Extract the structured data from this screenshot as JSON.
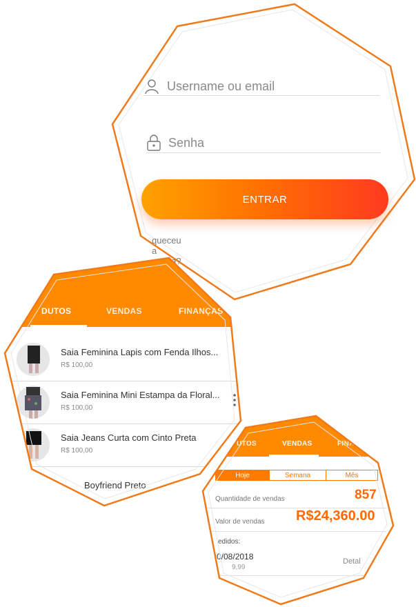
{
  "login": {
    "username_placeholder": "Username ou email",
    "password_placeholder": "Senha",
    "submit_label": "ENTRAR",
    "forgot_label": "queceu a senha?"
  },
  "products_screen": {
    "tabs": [
      "DUTOS",
      "VENDAS",
      "FINANÇAS"
    ],
    "items": [
      {
        "name": "Saia Feminina Lapis com Fenda Ilhos...",
        "price": "R$ 100,00"
      },
      {
        "name": "Saia Feminina Mini Estampa da Floral...",
        "price": "R$ 100,00"
      },
      {
        "name": "Saia Jeans Curta com Cinto Preta",
        "price": "R$ 100,00"
      },
      {
        "name": "Boyfriend Preto",
        "price": ""
      }
    ]
  },
  "sales_screen": {
    "tabs": [
      "UTOS",
      "VENDAS",
      "FINA"
    ],
    "periods": [
      "Hoje",
      "Semana",
      "Mês"
    ],
    "quantity_label": "Quantidade de vendas",
    "quantity_value": "857",
    "value_label": "Valor de vendas",
    "value_amount": "R$24,360.00",
    "orders_label": "edidos:",
    "order_date": "0/08/2018",
    "order_amount": "9,99",
    "order_details": "Detal"
  },
  "colors": {
    "accent": "#ff8a00",
    "gradient_start": "#ffa200",
    "gradient_end": "#ff3a1f",
    "outline": "#f07a1a"
  }
}
